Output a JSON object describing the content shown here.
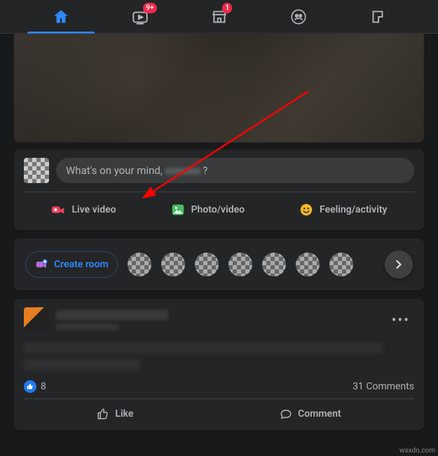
{
  "nav": {
    "badges": {
      "watch": "9+",
      "marketplace": "1"
    }
  },
  "composer": {
    "placeholder_prefix": "What's on your mind, ",
    "placeholder_suffix": " ?",
    "actions": {
      "live": "Live video",
      "photo": "Photo/video",
      "feeling": "Feeling/activity"
    }
  },
  "rooms": {
    "create_label": "Create room"
  },
  "post": {
    "like_count": "8",
    "comments_label": "31 Comments",
    "like_label": "Like",
    "comment_label": "Comment"
  },
  "watermark": "wsxdn.com"
}
